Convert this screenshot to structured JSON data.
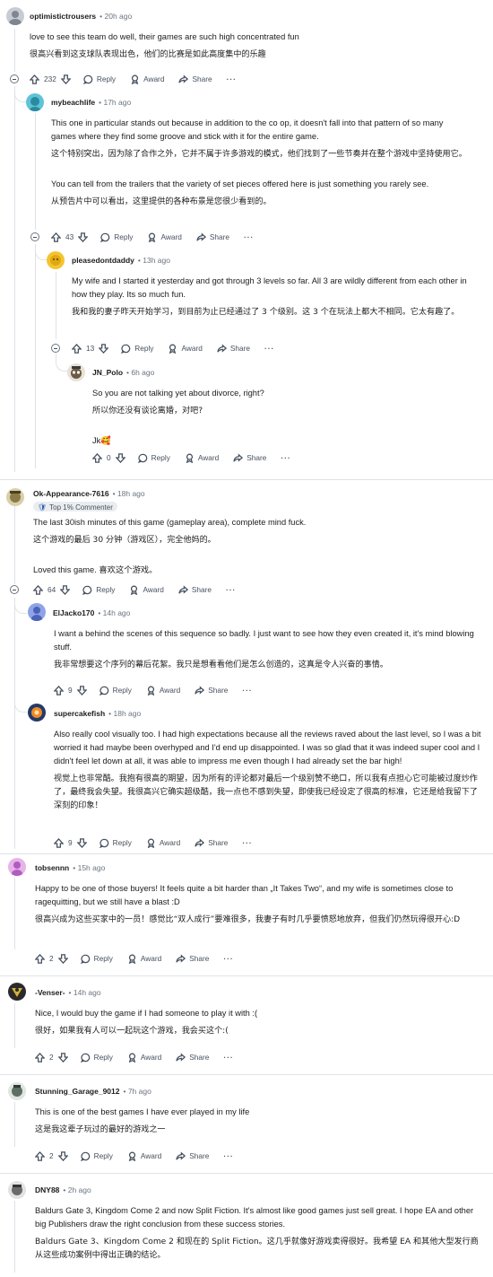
{
  "actions": {
    "reply": "Reply",
    "award": "Award",
    "share": "Share"
  },
  "comments": [
    {
      "user": "optimistictrousers",
      "time": "• 20h ago",
      "en": "love to see this team do well, their games are such high concentrated fun",
      "zh": "很高兴看到这支球队表现出色，他们的比赛是如此高度集中的乐趣",
      "votes": "232"
    },
    {
      "user": "mybeachlife",
      "time": "• 17h ago",
      "en": "This one in particular stands out because in addition to the co op, it doesn't fall into that pattern of so many games where they find some groove and stick with it for the entire game.",
      "zh": "这个特别突出，因为除了合作之外，它并不属于许多游戏的模式，他们找到了一些节奏并在整个游戏中坚持使用它。",
      "en2": "You can tell from the trailers that the variety of set pieces offered here is just something you rarely see.",
      "zh2": "从预告片中可以看出，这里提供的各种布景是您很少看到的。",
      "votes": "43"
    },
    {
      "user": "pleasedontdaddy",
      "time": "• 13h ago",
      "en": "My wife and I started it yesterday and got through 3 levels so far. All 3 are wildly different from each other in how they play. Its so much fun.",
      "zh": "我和我的妻子昨天开始学习，到目前为止已经通过了 3 个级别。这 3 个在玩法上都大不相同。它太有趣了。",
      "votes": "13"
    },
    {
      "user": "JN_Polo",
      "time": "• 6h ago",
      "en": "So you are not talking yet about divorce, right?",
      "zh": "所以你还没有谈论离婚，对吧?",
      "en2": "Jk🥰",
      "votes": "0"
    },
    {
      "user": "Ok-Appearance-7616",
      "time": "• 18h ago",
      "badge": "Top 1% Commenter",
      "en": "The last 30ish minutes of this game (gameplay area), complete mind fuck.",
      "zh": "这个游戏的最后 30 分钟（游戏区），完全他妈的。",
      "en2": "Loved this game.   喜欢这个游戏。",
      "votes": "64"
    },
    {
      "user": "ElJacko170",
      "time": "• 14h ago",
      "en": "I want a behind the scenes of this sequence so badly. I just want to see how they even created it, it's mind blowing stuff.",
      "zh": "我非常想要这个序列的幕后花絮。我只是想看看他们是怎么创造的，这真是令人兴奋的事情。",
      "votes": "9"
    },
    {
      "user": "supercakefish",
      "time": "• 18h ago",
      "en": "Also really cool visually too. I had high expectations because all the reviews raved about the last level, so I was a bit worried it had maybe been overhyped and I'd end up disappointed. I was so glad that it was indeed super cool and I didn't feel let down at all, it was able to impress me even though I had already set the bar high!",
      "zh": "视觉上也非常酷。我抱有很高的期望，因为所有的评论都对最后一个级别赞不绝口，所以我有点担心它可能被过度炒作了，最终我会失望。我很高兴它确实超级酷，我一点也不感到失望，即使我已经设定了很高的标准，它还是给我留下了深刻的印象！",
      "votes": "9"
    },
    {
      "user": "tobsennn",
      "time": "• 15h ago",
      "en": "Happy to be one of those buyers! It feels quite a bit harder than „It Takes Two“, and my wife is sometimes close to ragequitting, but we still have a blast :D",
      "zh": "很高兴成为这些买家中的一员！感觉比“双人成行”要难很多，我妻子有时几乎要愤怒地放弃，但我们仍然玩得很开心:D",
      "votes": "2"
    },
    {
      "user": "-Venser-",
      "time": "• 14h ago",
      "en": "Nice, I would buy the game if I had someone to play it with :(",
      "zh": "很好，如果我有人可以一起玩这个游戏，我会买这个:(",
      "votes": "2"
    },
    {
      "user": "Stunning_Garage_9012",
      "time": "• 7h ago",
      "en": "This is one of the best games I have ever played in my life",
      "zh": "这是我这辈子玩过的最好的游戏之一",
      "votes": "2"
    },
    {
      "user": "DNY88",
      "time": "• 2h ago",
      "en": "Baldurs Gate 3, Kingdom Come 2 and now Split Fiction. It's almost like good games just sell great. I hope EA and other big Publishers draw the right conclusion from these success stories.",
      "zh": "Baldurs Gate 3、Kingdom Come 2 和现在的 Split Fiction。这几乎就像好游戏卖得很好。我希望 EA 和其他大型发行商从这些成功案例中得出正确的结论。"
    }
  ]
}
